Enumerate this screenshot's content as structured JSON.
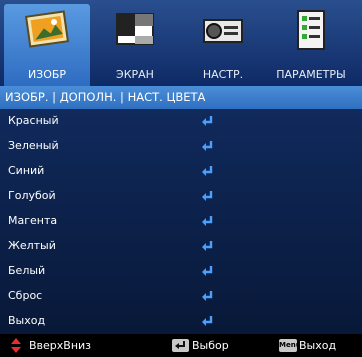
{
  "tabs": [
    {
      "label": "ИЗОБР",
      "icon": "image-icon",
      "active": true
    },
    {
      "label": "ЭКРАН",
      "icon": "screen-icon",
      "active": false
    },
    {
      "label": "НАСТР.",
      "icon": "setup-projector-icon",
      "active": false
    },
    {
      "label": "ПАРАМЕТРЫ",
      "icon": "options-list-icon",
      "active": false
    }
  ],
  "breadcrumb": "ИЗОБР. | ДОПОЛН. | НАСТ. ЦВЕТА",
  "items": [
    {
      "label": "Красный"
    },
    {
      "label": "Зеленый"
    },
    {
      "label": "Синий"
    },
    {
      "label": "Голубой"
    },
    {
      "label": "Магента"
    },
    {
      "label": "Желтый"
    },
    {
      "label": "Белый"
    },
    {
      "label": "Сброс"
    },
    {
      "label": "Выход"
    }
  ],
  "footer": {
    "updown_label": "ВверхВниз",
    "select_label": "Выбор",
    "menu_key": "Menu",
    "exit_label": "Выход"
  },
  "colors": {
    "accent": "#2f6fc0",
    "enter_arrow": "#4aa0ff",
    "updown_arrow": "#e53030"
  }
}
